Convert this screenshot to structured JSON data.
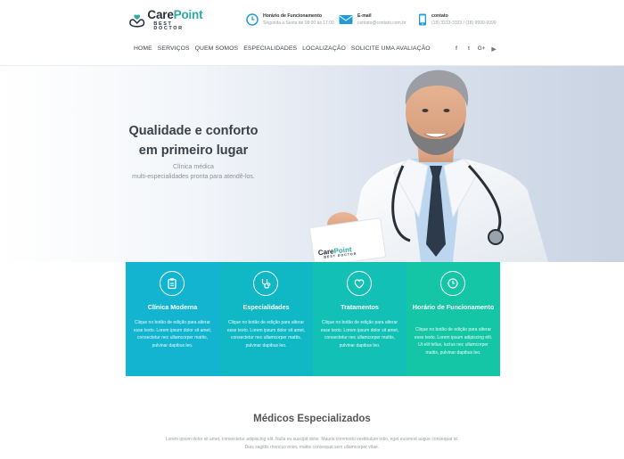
{
  "header": {
    "logo": {
      "name_part1": "Care",
      "name_part2": "Point",
      "tagline": "BEST DOCTOR"
    },
    "hours": {
      "title": "Horário de Funcionamento",
      "value": "Segunda a Sexta de 08:00 às 17:00",
      "icon": "clock-icon"
    },
    "email": {
      "title": "E-mail",
      "value": "contato@contato.com.br",
      "icon": "envelope-icon"
    },
    "contact": {
      "title": "contato",
      "value": "(18) 3333-3333 / (18) 9999-9999",
      "icon": "phone-icon"
    }
  },
  "nav": {
    "items": [
      {
        "label": "HOME"
      },
      {
        "label": "SERVIÇOS"
      },
      {
        "label": "QUEM SOMOS"
      },
      {
        "label": "ESPECIALIDADES"
      },
      {
        "label": "LOCALIZAÇÃO"
      },
      {
        "label": "SOLICITE UMA AVALIAÇÃO"
      }
    ],
    "social": [
      {
        "label": "f",
        "icon": "facebook-icon"
      },
      {
        "label": "t",
        "icon": "twitter-icon"
      },
      {
        "label": "G+",
        "icon": "google-plus-icon"
      },
      {
        "label": "▶",
        "icon": "youtube-icon"
      }
    ]
  },
  "hero": {
    "title_line1": "Qualidade e conforto",
    "title_line2": "em primeiro lugar",
    "sub_line1": "Clínica médica",
    "sub_line2": "multi-especialidades pronta para atendê-los.",
    "card_logo": {
      "name_part1": "Care",
      "name_part2": "Point",
      "tagline": "BEST DOCTOR"
    }
  },
  "features": [
    {
      "title": "Clínica Moderna",
      "icon": "clipboard-icon",
      "text": "Clique no botão de edição para alterar esse texto. Lorem ipsum dolor sit amet, consectetur nec ullamcorper mattis, pulvinar dapibus leo."
    },
    {
      "title": "Especialidades",
      "icon": "stethoscope-icon",
      "text": "Clique no botão de edição para alterar esse texto. Lorem ipsum dolor sit amet, consectetur nec ullamcorper mattis, pulvinar dapibus leo."
    },
    {
      "title": "Tratamentos",
      "icon": "heart-icon",
      "text": "Clique no botão de edição para alterar esse texto. Lorem ipsum dolor sit amet, consectetur nec ullamcorper mattis, pulvinar dapibus leo."
    },
    {
      "title": "Horário de Funcionamento",
      "icon": "clock-icon",
      "text": "Clique no botão de edição para alterar esse texto. Lorem ipsum adipiscing elit. Ut elit tellus, luctus nec ullamcorper mattis, pulvinar dapibus leo."
    }
  ],
  "specialists": {
    "title": "Médicos Especializados",
    "text": "Lorem ipsum dolor sit amet, consectetur adipiscing elit. Nulla eu suscipit dolor. Mauris commodo vestibulum odio, eget euismod augue consequat id. Duis sagittis rhoncus enim, mattis consequat sem ullamcorper vitae."
  },
  "colors": {
    "brand_dark": "#28323c",
    "brand_teal": "#2faaa5",
    "feature_blue": "#13b4cf",
    "feature_green": "#15c6a6"
  }
}
